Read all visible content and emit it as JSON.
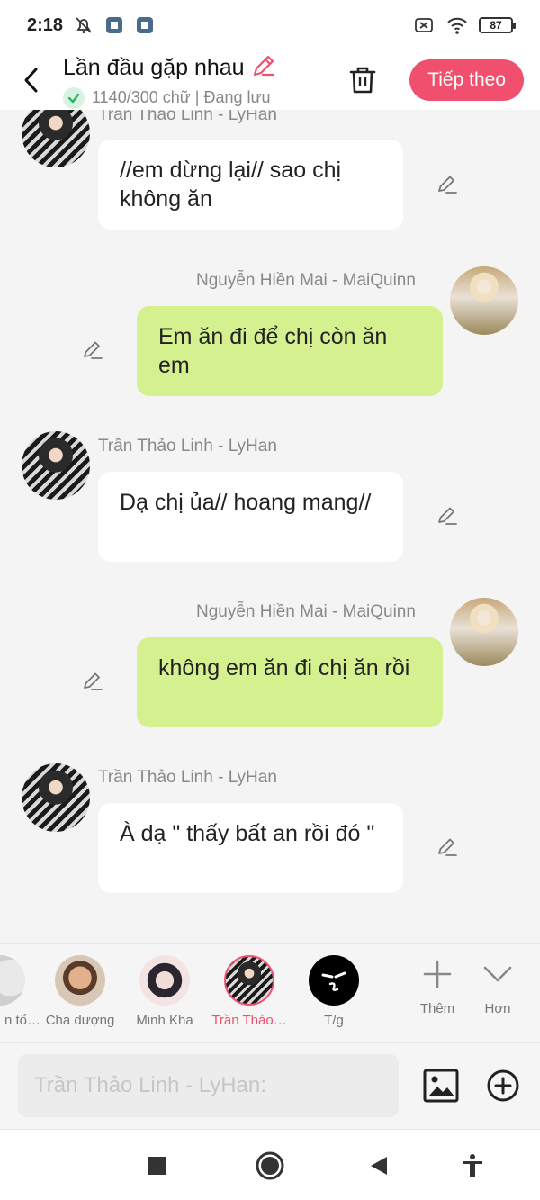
{
  "status_bar": {
    "time": "2:18",
    "battery": "87"
  },
  "header": {
    "title": "Lần đầu gặp nhau",
    "word_count": "1140/300 chữ | Đang lưu",
    "next_label": "Tiếp theo"
  },
  "messages": [
    {
      "speaker": "Trần Thảo Linh - LyHan",
      "text": "//em dừng lại// sao chị không ăn",
      "side": "left"
    },
    {
      "speaker": "Nguyễn Hiền Mai - MaiQuinn",
      "text": "Em ăn đi để chị còn ăn em",
      "side": "right"
    },
    {
      "speaker": "Trần Thảo Linh - LyHan",
      "text": "Dạ chị ủa// hoang mang//",
      "side": "left"
    },
    {
      "speaker": "Nguyễn Hiền Mai - MaiQuinn",
      "text": "không em ăn đi chị ăn rồi",
      "side": "right"
    },
    {
      "speaker": "Trần Thảo Linh - LyHan",
      "text": "À dạ \" thấy bất an rồi đó \"",
      "side": "left"
    }
  ],
  "characters": [
    {
      "name": "n tổ…",
      "selected": false
    },
    {
      "name": "Cha dượng",
      "selected": false
    },
    {
      "name": "Minh Kha",
      "selected": false
    },
    {
      "name": "Trần Thảo…",
      "selected": true
    },
    {
      "name": "T/g",
      "selected": false
    }
  ],
  "tools": {
    "add_label": "Thêm",
    "more_label": "Hơn"
  },
  "input": {
    "placeholder": "Trần Thảo Linh - LyHan:"
  },
  "colors": {
    "accent": "#f0506e",
    "bubble_right": "#d4f08f",
    "bubble_left": "#ffffff",
    "background": "#f4f4f4"
  }
}
